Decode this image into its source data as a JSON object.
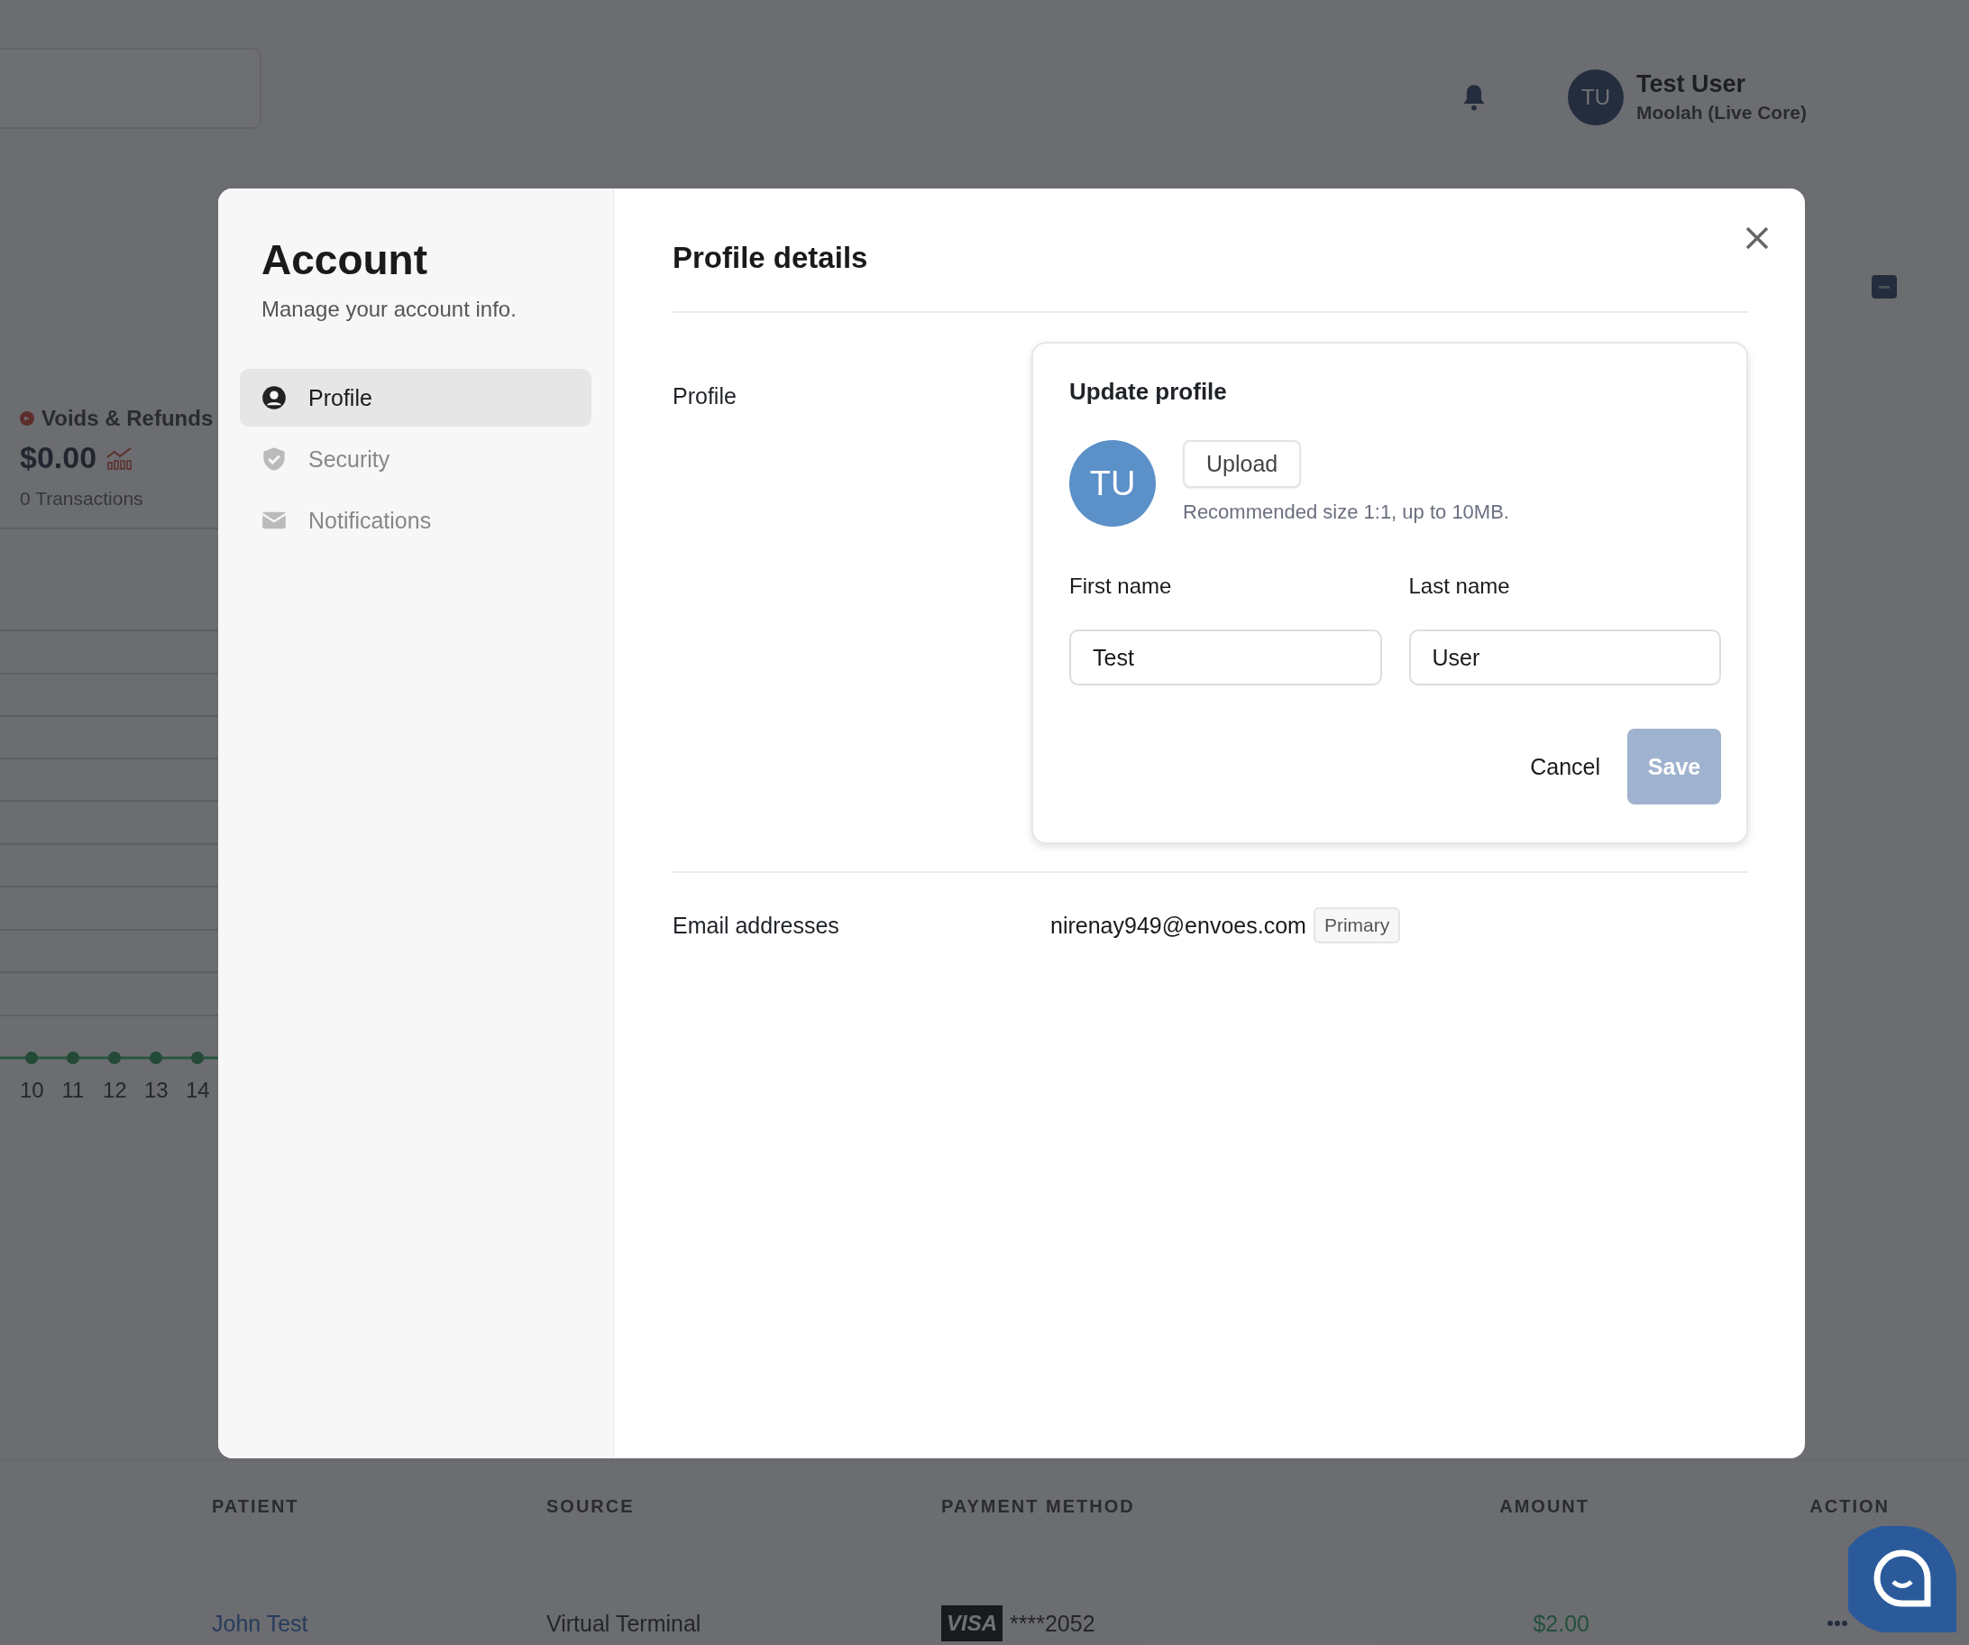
{
  "header": {
    "user": {
      "initials": "TU",
      "name": "Test User",
      "org": "Moolah (Live Core)"
    }
  },
  "stats": {
    "title": "Voids & Refunds",
    "amount": "$0.00",
    "count": "0 Transactions"
  },
  "chart": {
    "x_labels": [
      "10",
      "11",
      "12",
      "13",
      "14"
    ]
  },
  "table": {
    "columns": [
      "PATIENT",
      "SOURCE",
      "PAYMENT METHOD",
      "AMOUNT",
      "ACTION"
    ],
    "rows": [
      {
        "patient": "John Test",
        "source": "Virtual Terminal",
        "card_brand": "VISA",
        "card_number": "****2052",
        "amount": "$2.00"
      }
    ]
  },
  "modal": {
    "title": "Account",
    "subtitle": "Manage your account info.",
    "nav": [
      {
        "label": "Profile",
        "kind": "user",
        "selected": true
      },
      {
        "label": "Security",
        "kind": "shield",
        "selected": false
      },
      {
        "label": "Notifications",
        "kind": "mail",
        "selected": false
      }
    ],
    "heading": "Profile details",
    "profile": {
      "label": "Profile",
      "card": {
        "title": "Update profile",
        "initials": "TU",
        "upload": "Upload",
        "hint": "Recommended size 1:1, up to 10MB.",
        "fields": [
          {
            "label": "First name",
            "value": "Test"
          },
          {
            "label": "Last name",
            "value": "User"
          }
        ],
        "cancel": "Cancel",
        "save": {
          "label": "Save",
          "disabled": true
        }
      }
    },
    "emails": {
      "label": "Email addresses",
      "items": [
        {
          "address": "nirenay949@envoes.com",
          "badge": "Primary"
        }
      ]
    }
  }
}
